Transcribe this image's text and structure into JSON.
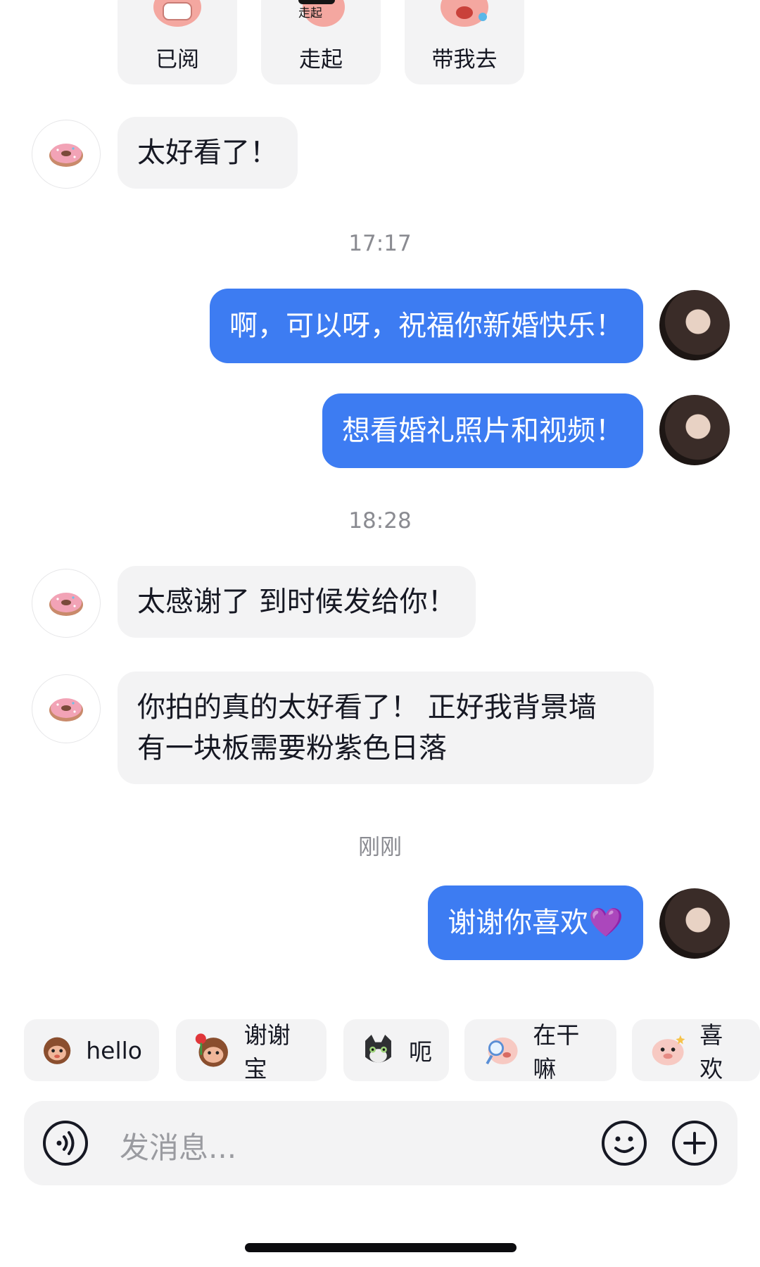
{
  "top_stickers": [
    {
      "label": "已阅",
      "icon": "pig-mask-sticker-icon"
    },
    {
      "label": "走起",
      "icon": "pig-sunglasses-sticker-icon",
      "sticker_text": "走起"
    },
    {
      "label": "带我去",
      "icon": "pig-crying-sticker-icon"
    }
  ],
  "messages": {
    "m1": "太好看了！",
    "t1": "17:17",
    "m2": "啊，可以呀，祝福你新婚快乐！",
    "m3": "想看婚礼照片和视频！",
    "t2": "18:28",
    "m4": "太感谢了 到时候发给你！",
    "m5_line1": "你拍的真的太好看了！ 正好我背景墙",
    "m5_line2": "有一块板需要粉紫色日落",
    "t3": "刚刚",
    "m6": "谢谢你喜欢💜"
  },
  "quick_replies": [
    {
      "label": "hello",
      "icon": "monkey-wave-icon"
    },
    {
      "label": "谢谢宝",
      "icon": "monkey-rose-icon"
    },
    {
      "label": "呃",
      "icon": "cat-face-icon"
    },
    {
      "label": "在干嘛",
      "icon": "pig-magnifier-icon"
    },
    {
      "label": "喜欢",
      "icon": "pig-heart-icon"
    }
  ],
  "input": {
    "placeholder": "发消息..."
  },
  "icons": {
    "voice": "voice-icon",
    "emoji": "emoji-icon",
    "plus": "plus-icon"
  },
  "colors": {
    "out_bubble": "#3d7cf2",
    "in_bubble": "#f3f3f4",
    "time_text": "#8a8b91"
  }
}
